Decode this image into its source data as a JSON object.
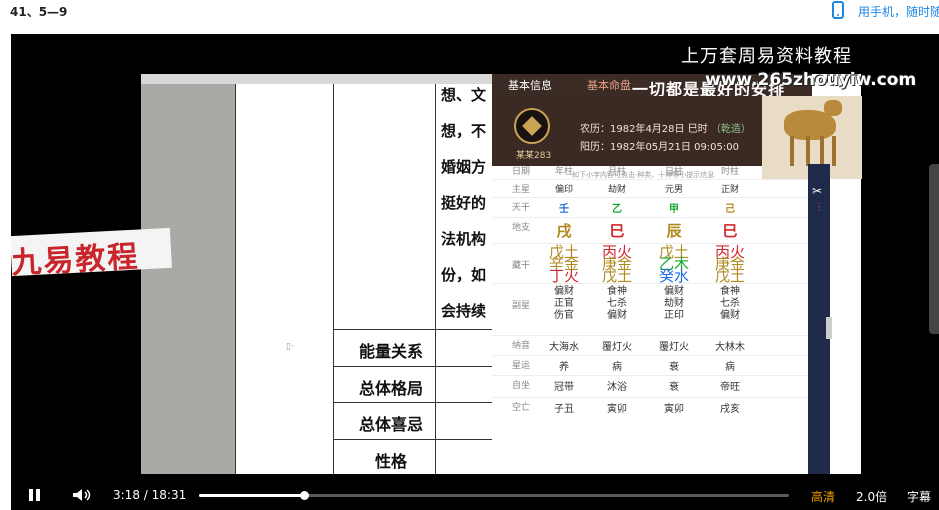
{
  "page": {
    "lesson_title": "41、5—9",
    "phone_link": "用手机，随时随"
  },
  "video": {
    "watermark": "上万套周易资料教程",
    "watermark_url": "www.265zhouyiw.com",
    "banner": "九易教程"
  },
  "slide": {
    "text_lines": [
      "想、文",
      "想，不",
      "婚姻方",
      "挺好的",
      "法机构",
      "份，如",
      "会持续"
    ],
    "row_labels": [
      "能量关系",
      "总体格局",
      "总体喜忌",
      "性格"
    ]
  },
  "panel": {
    "tabs": [
      "基本信息",
      "基本命盘"
    ],
    "banner_text": "一切都是最好的安排",
    "person_name": "某某283",
    "lunar_label": "农历：1982年4月28日 巳时",
    "lunar_tag": "（乾造）",
    "solar_label": "阳历：1982年05月21日 09:05:00",
    "note": "如下小字内容可点击·种类、十神等小提示信息",
    "columns": [
      "日期",
      "年柱",
      "月柱",
      "日柱",
      "时柱"
    ],
    "rows": [
      {
        "label": "主星",
        "values": [
          "偏印",
          "劫财",
          "元男",
          "正财"
        ]
      },
      {
        "label": "天干",
        "values": [
          "壬",
          "乙",
          "甲",
          "己"
        ],
        "colors": [
          "#1e6ddc",
          "#15a82e",
          "#15a82e",
          "#b08a1f"
        ]
      },
      {
        "label": "地支",
        "values": [
          "戌",
          "巳",
          "辰",
          "巳"
        ],
        "colors": [
          "#b08a1f",
          "#d0282d",
          "#b08a1f",
          "#d0282d"
        ]
      },
      {
        "label": "藏干",
        "values": [
          [
            "戊土",
            "辛金",
            "丁火"
          ],
          [
            "丙火",
            "庚金",
            "戊土"
          ],
          [
            "戊土",
            "乙木",
            "癸水"
          ],
          [
            "丙火",
            "庚金",
            "戊土"
          ]
        ],
        "colors": [
          [
            "#b08a1f",
            "#b08a1f",
            "#d0282d"
          ],
          [
            "#d0282d",
            "#b08a1f",
            "#b08a1f"
          ],
          [
            "#b08a1f",
            "#15a82e",
            "#1e6ddc"
          ],
          [
            "#d0282d",
            "#b08a1f",
            "#b08a1f"
          ]
        ]
      },
      {
        "label": "副星",
        "values": [
          [
            "偏财",
            "正官",
            "伤官"
          ],
          [
            "食神",
            "七杀",
            "偏财"
          ],
          [
            "偏财",
            "劫财",
            "正印"
          ],
          [
            "食神",
            "七杀",
            "偏财"
          ]
        ]
      },
      {
        "label": "纳音",
        "values": [
          "大海水",
          "覆灯火",
          "覆灯火",
          "大林木"
        ]
      },
      {
        "label": "星运",
        "values": [
          "养",
          "病",
          "衰",
          "病"
        ]
      },
      {
        "label": "自坐",
        "values": [
          "冠带",
          "沐浴",
          "衰",
          "帝旺"
        ]
      },
      {
        "label": "空亡",
        "values": [
          "子丑",
          "寅卯",
          "寅卯",
          "戌亥"
        ]
      }
    ]
  },
  "controls": {
    "current_time": "3:18",
    "separator": "/",
    "duration": "18:31",
    "progress_fraction": 0.178,
    "quality": "高清",
    "speed": "2.0倍",
    "subtitles": "字幕"
  }
}
